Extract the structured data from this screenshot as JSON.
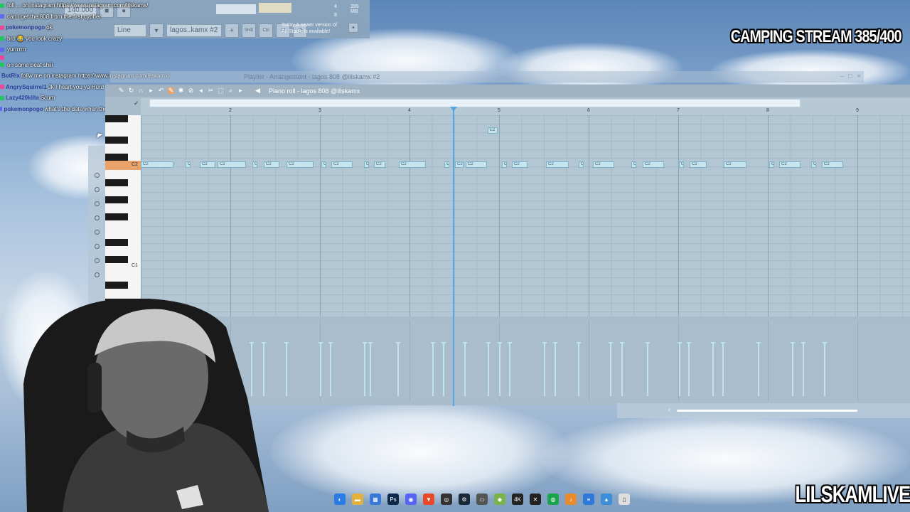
{
  "overlay": {
    "stream_title": "CAMPING STREAM 385/400",
    "brand": "LILSKAMLIVE"
  },
  "chat": [
    {
      "user": "",
      "msg": "foll ... on instagram https://www.instagram.com/lilskamx/"
    },
    {
      "user": "",
      "msg": "can i get the 808 from the first cypher"
    },
    {
      "user": "pokemonpogo",
      "msg": "ok"
    },
    {
      "user": "",
      "msg": "bro 😂 you look crazy"
    },
    {
      "user": "",
      "msg": "yurrrrrrr"
    },
    {
      "user": "",
      "msg": ""
    },
    {
      "user": "",
      "msg": "on some beat shiii"
    },
    {
      "user": "BotRix",
      "msg": "follw me on instagram https://www.instagram.com/lilskamx/"
    },
    {
      "user": "AngrySquirrel1",
      "msg": "Jk I heart you ya Hurd"
    },
    {
      "user": "Lazy420killa",
      "msg": "Scum"
    },
    {
      "user": "pokemonpogo",
      "msg": "what's the date when the mask dropping?"
    }
  ],
  "toolbar": {
    "tempo": "140.000",
    "snap": "Line",
    "pattern": "lagos..kamx #2",
    "cpu": "4",
    "memory": "399 MB",
    "cpu_extra": "8",
    "shift_label": "Shift",
    "ctrl_label": "Ctrl",
    "alt_label": "Alt",
    "news_line1": "Today  A newer version of",
    "news_line2": "FL Studio is available!"
  },
  "playlist": {
    "title": "Playlist - Arrangement - lagos 808 @lilskamx #2"
  },
  "piano_roll": {
    "title": "Piano roll - lagos 808 @lilskamx",
    "bars": [
      "2",
      "3",
      "4",
      "5",
      "6",
      "7",
      "8",
      "9"
    ],
    "key_c2": "C2",
    "key_c1": "C1",
    "note_label": "C2",
    "high_note_label": "E2"
  },
  "colors": {
    "playhead": "#54a6e3",
    "note_fill": "#c6e4ef",
    "c2_key": "#e9a36a"
  }
}
